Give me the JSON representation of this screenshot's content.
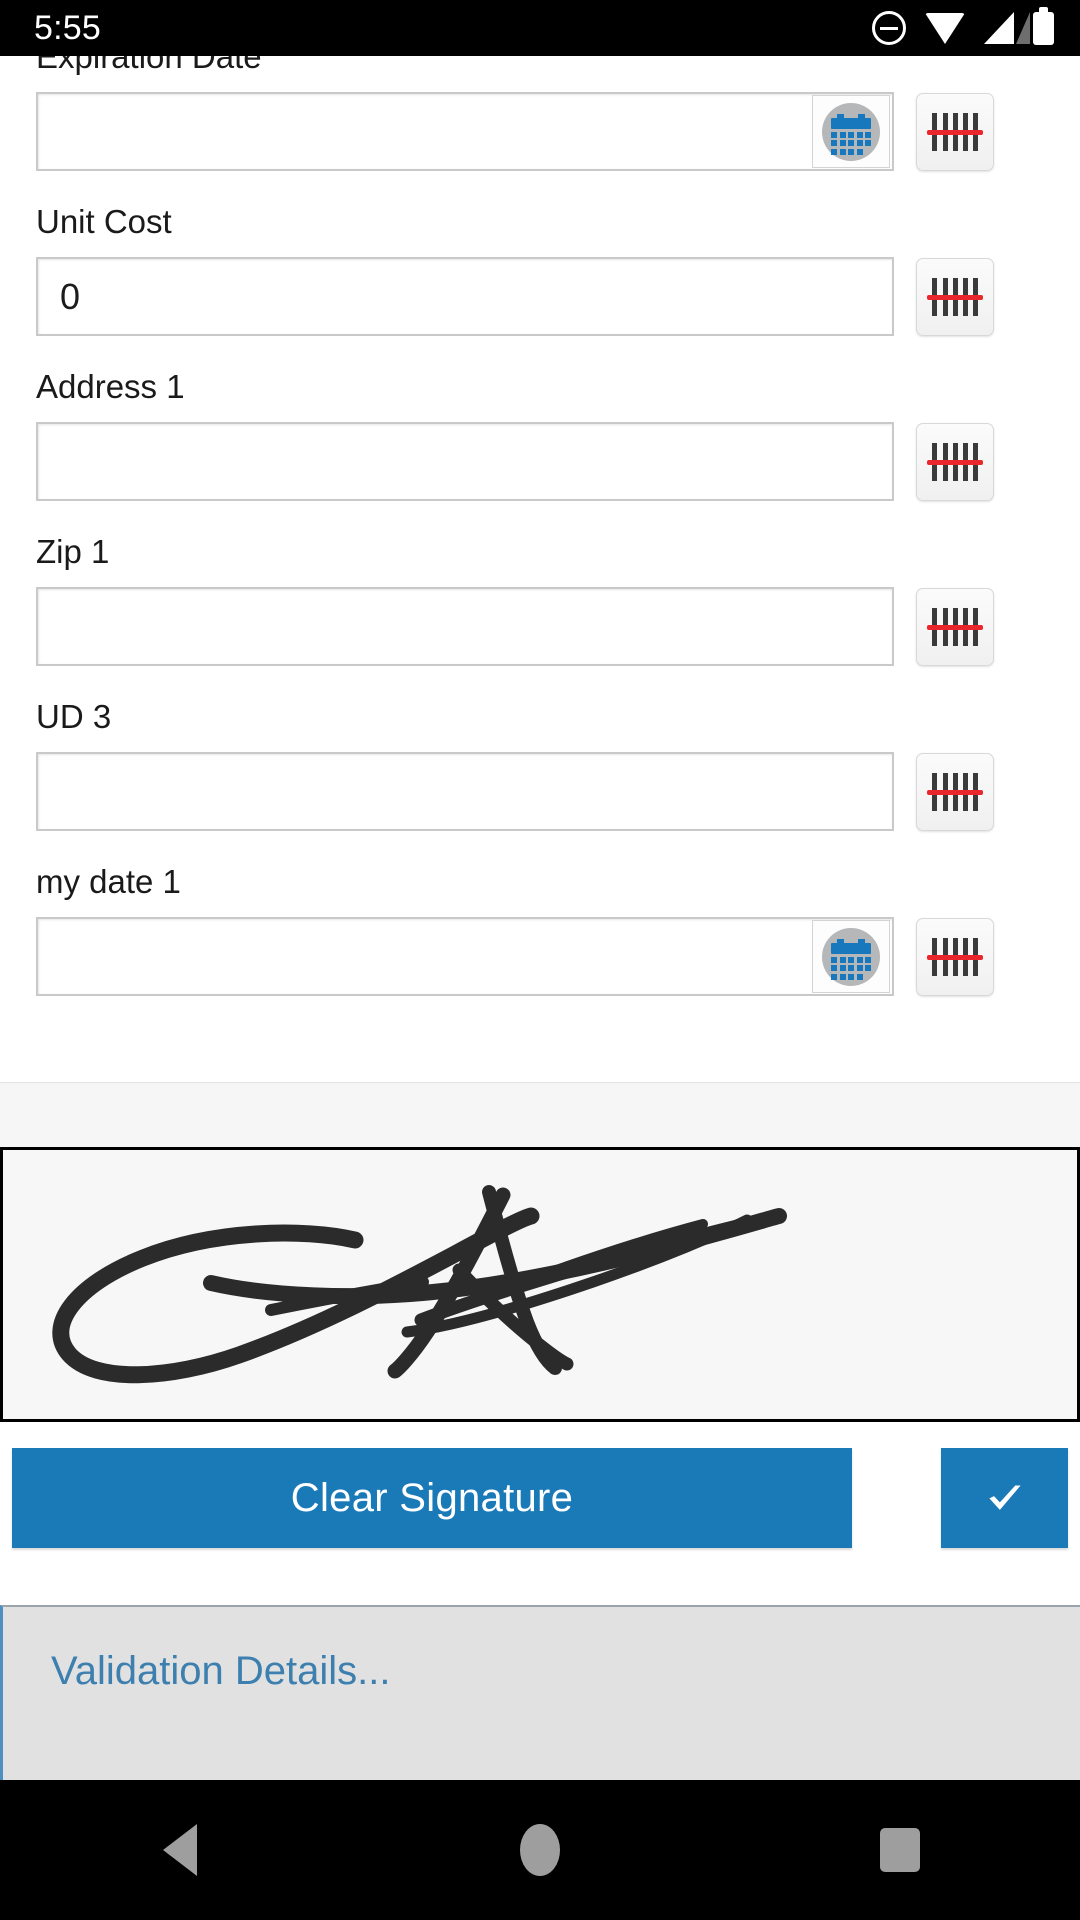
{
  "status_bar": {
    "time": "5:55",
    "icons": [
      "do-not-disturb-icon",
      "wifi-icon",
      "cellular-signal-icon",
      "battery-icon"
    ]
  },
  "form": {
    "fields": [
      {
        "label": "Expiration Date",
        "value": "",
        "placeholder": "",
        "type": "date",
        "has_calendar_button": true,
        "has_scan_button": true,
        "clipped_top": true
      },
      {
        "label": "Unit Cost",
        "value": "0",
        "placeholder": "",
        "type": "text",
        "has_calendar_button": false,
        "has_scan_button": true
      },
      {
        "label": "Address 1",
        "value": "",
        "placeholder": "",
        "type": "text",
        "has_calendar_button": false,
        "has_scan_button": true
      },
      {
        "label": "Zip 1",
        "value": "",
        "placeholder": "",
        "type": "text",
        "has_calendar_button": false,
        "has_scan_button": true
      },
      {
        "label": "UD 3",
        "value": "",
        "placeholder": "",
        "type": "text",
        "has_calendar_button": false,
        "has_scan_button": true
      },
      {
        "label": "my date 1",
        "value": "",
        "placeholder": "",
        "type": "date",
        "has_calendar_button": true,
        "has_scan_button": true
      }
    ]
  },
  "signature": {
    "pad_label": "signature-canvas",
    "has_signature": true,
    "ink_color": "#2b2b2b",
    "pad_background": "#f7f7f7"
  },
  "actions": {
    "clear_label": "Clear Signature",
    "confirm_icon": "checkmark-icon",
    "accent_color": "#1a7ab8"
  },
  "validation": {
    "text": "Validation Details...",
    "text_color": "#3d7fae",
    "panel_color": "#e1e1e1"
  },
  "navigation_bar": {
    "back": "back-nav-icon",
    "home": "home-nav-icon",
    "recents": "recents-nav-icon"
  }
}
